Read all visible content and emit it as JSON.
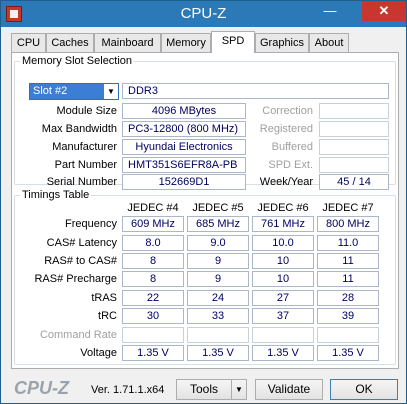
{
  "window": {
    "title": "CPU-Z"
  },
  "tabs": [
    {
      "label": "CPU"
    },
    {
      "label": "Caches"
    },
    {
      "label": "Mainboard"
    },
    {
      "label": "Memory"
    },
    {
      "label": "SPD"
    },
    {
      "label": "Graphics"
    },
    {
      "label": "About"
    }
  ],
  "slot": {
    "group_title": "Memory Slot Selection",
    "selected": "Slot #2",
    "type": "DDR3",
    "module_size_label": "Module Size",
    "module_size": "4096 MBytes",
    "max_bandwidth_label": "Max Bandwidth",
    "max_bandwidth": "PC3-12800 (800 MHz)",
    "manufacturer_label": "Manufacturer",
    "manufacturer": "Hyundai Electronics",
    "part_number_label": "Part Number",
    "part_number": "HMT351S6EFR8A-PB",
    "serial_number_label": "Serial Number",
    "serial_number": "152669D1",
    "correction_label": "Correction",
    "registered_label": "Registered",
    "buffered_label": "Buffered",
    "spd_ext_label": "SPD Ext.",
    "week_year_label": "Week/Year",
    "week_year": "45 / 14"
  },
  "timings": {
    "group_title": "Timings Table",
    "columns": [
      "JEDEC #4",
      "JEDEC #5",
      "JEDEC #6",
      "JEDEC #7"
    ],
    "rows": [
      {
        "label": "Frequency",
        "values": [
          "609 MHz",
          "685 MHz",
          "761 MHz",
          "800 MHz"
        ]
      },
      {
        "label": "CAS# Latency",
        "values": [
          "8.0",
          "9.0",
          "10.0",
          "11.0"
        ]
      },
      {
        "label": "RAS# to CAS#",
        "values": [
          "8",
          "9",
          "10",
          "11"
        ]
      },
      {
        "label": "RAS# Precharge",
        "values": [
          "8",
          "9",
          "10",
          "11"
        ]
      },
      {
        "label": "tRAS",
        "values": [
          "22",
          "24",
          "27",
          "28"
        ]
      },
      {
        "label": "tRC",
        "values": [
          "30",
          "33",
          "37",
          "39"
        ]
      },
      {
        "label": "Command Rate",
        "values": [
          "",
          "",
          "",
          ""
        ],
        "disabled": true
      },
      {
        "label": "Voltage",
        "values": [
          "1.35 V",
          "1.35 V",
          "1.35 V",
          "1.35 V"
        ]
      }
    ]
  },
  "footer": {
    "logo": "CPU-Z",
    "version": "Ver. 1.71.1.x64",
    "tools_label": "Tools",
    "validate_label": "Validate",
    "ok_label": "OK"
  }
}
